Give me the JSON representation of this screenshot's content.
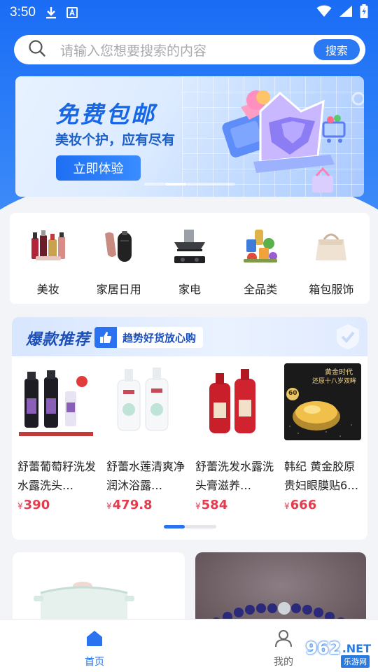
{
  "status_bar": {
    "time": "3:50"
  },
  "search": {
    "placeholder": "请输入您想要搜索的内容",
    "button_label": "搜索"
  },
  "banner": {
    "title": "免费包邮",
    "subtitle": "美妆个护，应有尽有",
    "button_label": "立即体验"
  },
  "categories": [
    {
      "label": "美妆",
      "icon": "cosmetics-icon"
    },
    {
      "label": "家居日用",
      "icon": "umbrella-icon"
    },
    {
      "label": "家电",
      "icon": "range-hood-icon"
    },
    {
      "label": "全品类",
      "icon": "groceries-icon"
    },
    {
      "label": "箱包服饰",
      "icon": "handbag-icon"
    }
  ],
  "hot": {
    "title": "爆款推荐",
    "tag": "趋势好货放心购",
    "products": [
      {
        "name": "舒蕾葡萄籽洗发水露洗头…",
        "currency": "¥",
        "price": "390"
      },
      {
        "name": "舒蕾水莲清爽净润沐浴露…",
        "currency": "¥",
        "price": "479.8"
      },
      {
        "name": "舒蕾洗发水露洗头膏滋养…",
        "currency": "¥",
        "price": "584"
      },
      {
        "name": "韩纪 黄金胶原贵妇眼膜贴6…",
        "currency": "¥",
        "price": "666"
      }
    ],
    "product4_promo": {
      "line1": "黄金时代",
      "line2": "还原十八岁双眸",
      "badge": "60"
    }
  },
  "tabs": [
    {
      "label": "首页",
      "active": true
    },
    {
      "label": "我的",
      "active": false
    }
  ],
  "watermark": {
    "logo": "962",
    "suffix": ".NET",
    "sub": "乐游网"
  },
  "colors": {
    "primary": "#1f6ff3",
    "price": "#e53b4d",
    "background": "#f3f4f8"
  }
}
